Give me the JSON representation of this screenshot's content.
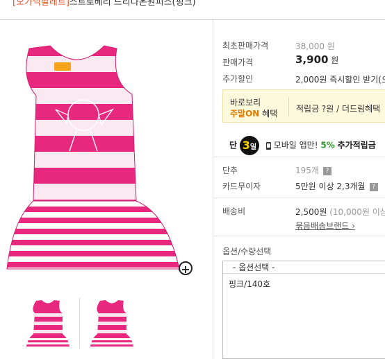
{
  "header": {
    "tag": "[오가닉팔레트]",
    "title": "스트로베리 드리나온원피스(핑크)"
  },
  "product": {
    "colors": {
      "pink": "#e8277f",
      "accent": "#e8542c",
      "green": "#2c9b2c"
    }
  },
  "info": {
    "list_price_label": "최초판매가격",
    "list_price": "38,000 원",
    "sale_price_label": "판매가격",
    "sale_price": "3,900",
    "sale_price_unit": "원",
    "extra_discount_label": "추가할인",
    "extra_discount": "2,000원 즉시할인 받기(오",
    "promo_line1": "바로보리",
    "promo_on": "주말ON",
    "promo_benefit": " 혜택",
    "promo_points": "적립금 ?원 / 더드림혜택",
    "mobile_prefix": "단",
    "mobile_day": "3",
    "mobile_day_unit": "일",
    "mobile_text": "모바일 앱만!",
    "mobile_percent": "5%",
    "mobile_bonus": "추가적립금",
    "qty_label": "단추",
    "qty_value": "195개",
    "card_label": "카드무이자",
    "card_value": "5만원 이상 2,3개월",
    "shipping_label": "배송비",
    "shipping_value": "2,500원",
    "shipping_note": "(10,000원 이상",
    "bundle_link": "묶음배송브랜드 ›"
  },
  "options": {
    "label": "옵션/수량선택",
    "select_placeholder": "- 옵션선택 -",
    "items": [
      "핑크/140호"
    ]
  }
}
